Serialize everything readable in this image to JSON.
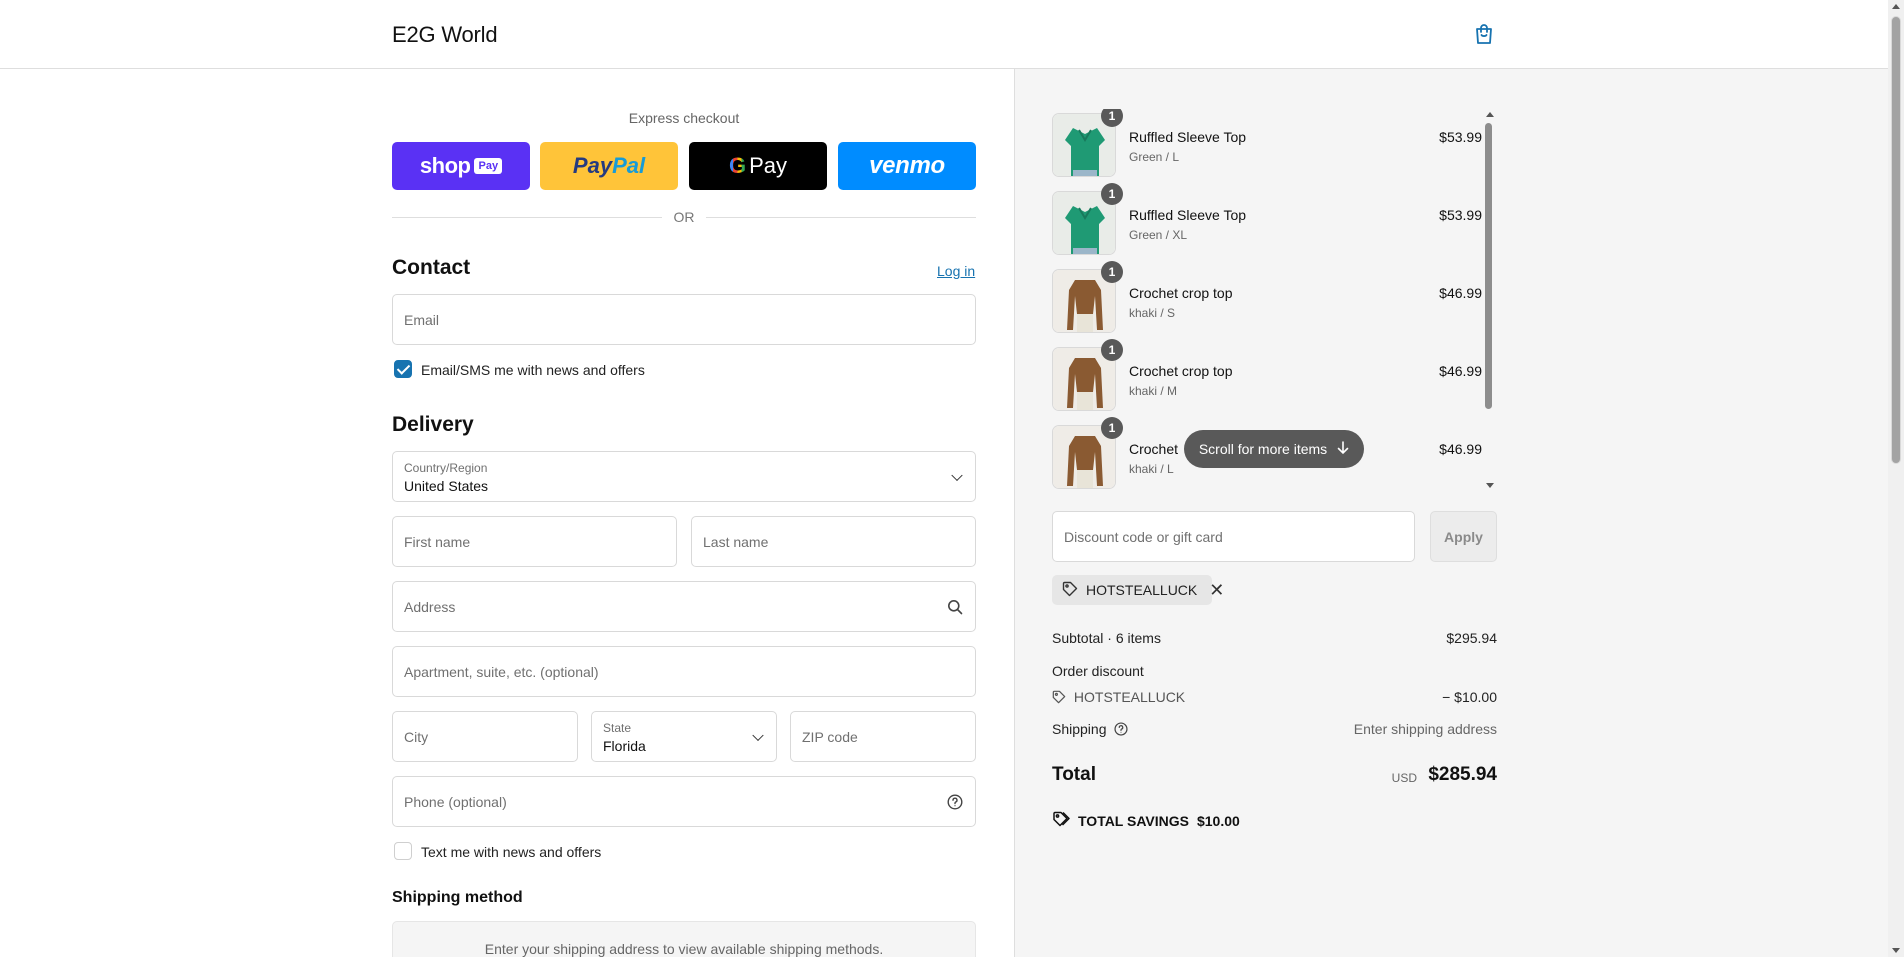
{
  "header": {
    "brand": "E2G World",
    "cart_icon": "shopping-bag-icon"
  },
  "express": {
    "title": "Express checkout",
    "shop_pay": "shop",
    "shop_pay_badge": "Pay",
    "paypal_a": "Pay",
    "paypal_b": "Pal",
    "gpay": "Pay",
    "venmo": "venmo",
    "or": "OR"
  },
  "contact": {
    "title": "Contact",
    "login": "Log in",
    "email_placeholder": "Email",
    "news_checkbox": "Email/SMS me with news and offers",
    "news_checked": true
  },
  "delivery": {
    "title": "Delivery",
    "country_label": "Country/Region",
    "country_value": "United States",
    "first_name": "First name",
    "last_name": "Last name",
    "address": "Address",
    "apartment": "Apartment, suite, etc. (optional)",
    "city": "City",
    "state_label": "State",
    "state_value": "Florida",
    "zip": "ZIP code",
    "phone": "Phone (optional)",
    "text_checkbox": "Text me with news and offers",
    "text_checked": false
  },
  "shipping_method": {
    "title": "Shipping method",
    "message": "Enter your shipping address to view available shipping methods."
  },
  "cart": {
    "items": [
      {
        "name": "Ruffled Sleeve Top",
        "variant": "Green / L",
        "price": "$53.99",
        "qty": "1",
        "color": "#1f9a74"
      },
      {
        "name": "Ruffled Sleeve Top",
        "variant": "Green / XL",
        "price": "$53.99",
        "qty": "1",
        "color": "#1f9a74"
      },
      {
        "name": "Crochet crop top",
        "variant": "khaki / S",
        "price": "$46.99",
        "qty": "1",
        "color": "#8a5a32"
      },
      {
        "name": "Crochet crop top",
        "variant": "khaki / M",
        "price": "$46.99",
        "qty": "1",
        "color": "#8a5a32"
      },
      {
        "name": "Crochet",
        "variant": "khaki / L",
        "price": "$46.99",
        "qty": "1",
        "color": "#8a5a32"
      }
    ],
    "scroll_hint": "Scroll for more items"
  },
  "discount": {
    "placeholder": "Discount code or gift card",
    "apply": "Apply",
    "code": "HOTSTEALLUCK"
  },
  "summary": {
    "subtotal_label": "Subtotal · 6 items",
    "subtotal": "$295.94",
    "order_discount_label": "Order discount",
    "discount_code": "HOTSTEALLUCK",
    "discount_amount": "− $10.00",
    "shipping_label": "Shipping",
    "shipping_value": "Enter shipping address",
    "total_label": "Total",
    "currency": "USD",
    "total": "$285.94",
    "savings_label": "TOTAL SAVINGS",
    "savings_amount": "$10.00"
  }
}
